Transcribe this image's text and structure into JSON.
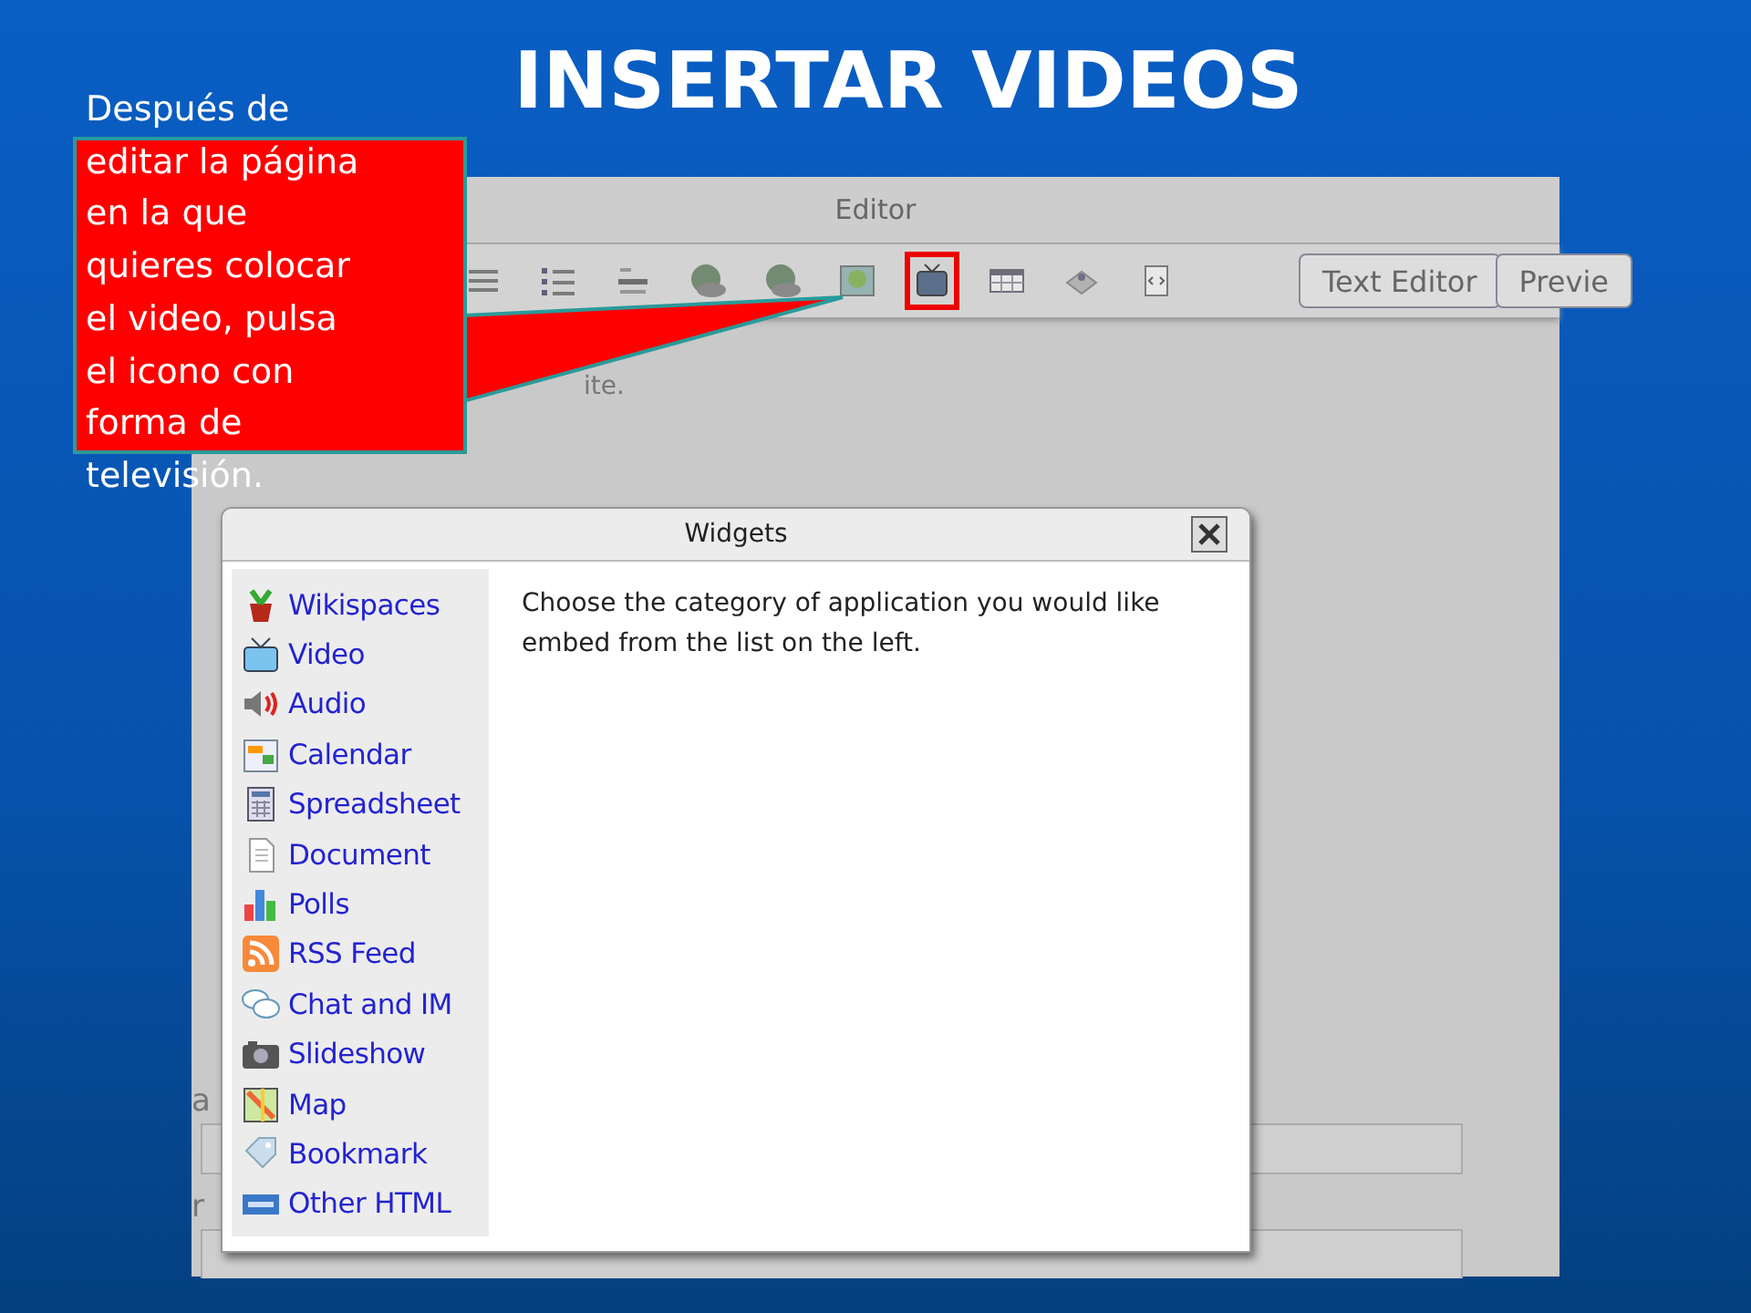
{
  "slide_title": "INSERTAR VIDEOS",
  "note_lines": [
    "Después de",
    "editar la página",
    "en la que",
    "quieres colocar",
    "el video, pulsa",
    "el icono con",
    "forma de",
    "televisión."
  ],
  "editor": {
    "title": "Editor",
    "toolbar": [
      {
        "kind": "align",
        "highlighted": false
      },
      {
        "kind": "bullets",
        "highlighted": false
      },
      {
        "kind": "indent",
        "highlighted": false
      },
      {
        "kind": "link",
        "highlighted": false
      },
      {
        "kind": "unlink",
        "highlighted": false
      },
      {
        "kind": "image",
        "highlighted": false
      },
      {
        "kind": "video",
        "highlighted": true
      },
      {
        "kind": "table",
        "highlighted": false
      },
      {
        "kind": "widget",
        "highlighted": false
      },
      {
        "kind": "code",
        "highlighted": false
      }
    ],
    "buttons": [
      "Text Editor",
      "Previe"
    ],
    "body_fragment": "ite.",
    "field_labels": [
      "a",
      "r"
    ]
  },
  "dialog": {
    "title": "Widgets",
    "items": [
      {
        "kind": "wikispaces",
        "label": "Wikispaces"
      },
      {
        "kind": "video",
        "label": "Video"
      },
      {
        "kind": "audio",
        "label": "Audio"
      },
      {
        "kind": "calendar",
        "label": "Calendar"
      },
      {
        "kind": "spreadsheet",
        "label": "Spreadsheet"
      },
      {
        "kind": "document",
        "label": "Document"
      },
      {
        "kind": "polls",
        "label": "Polls"
      },
      {
        "kind": "rss",
        "label": "RSS Feed"
      },
      {
        "kind": "chat",
        "label": "Chat and IM"
      },
      {
        "kind": "slideshow",
        "label": "Slideshow"
      },
      {
        "kind": "map",
        "label": "Map"
      },
      {
        "kind": "bookmark",
        "label": "Bookmark"
      },
      {
        "kind": "html",
        "label": "Other HTML"
      }
    ],
    "message_lines": [
      "Choose the category of application you would like",
      "embed from the list on the left."
    ]
  }
}
